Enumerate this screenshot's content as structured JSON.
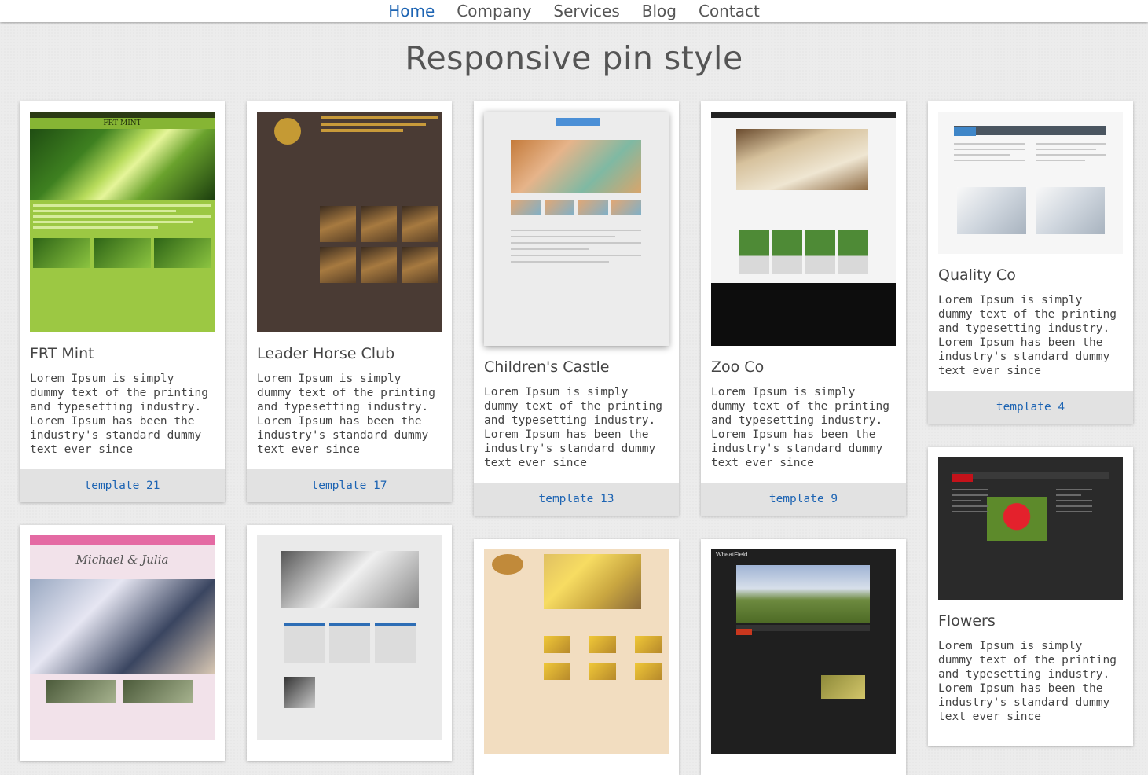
{
  "nav": {
    "items": [
      "Home",
      "Company",
      "Services",
      "Blog",
      "Contact"
    ],
    "active_index": 0
  },
  "heading": "Responsive pin style",
  "lorem": "Lorem Ipsum is simply dummy text of the printing and typesetting industry. Lorem Ipsum has been the industry's standard dummy text ever since",
  "cards": [
    {
      "title": "FRT Mint",
      "link": "template 21"
    },
    {
      "title": "Leader Horse Club",
      "link": "template 17"
    },
    {
      "title": "Children's Castle",
      "link": "template 13"
    },
    {
      "title": "Zoo Co",
      "link": "template 9"
    },
    {
      "title": "Quality Co",
      "link": "template 4"
    },
    {
      "title": "Flowers",
      "link": ""
    }
  ],
  "thumb_texts": {
    "mint_title": "FRT MINT",
    "wedding_names": "Michael & Julia",
    "wheat": "WheatField"
  },
  "colors": {
    "accent": "#1d64b3",
    "footer_bg": "#e2e2e2",
    "page_bg": "#ececec"
  }
}
